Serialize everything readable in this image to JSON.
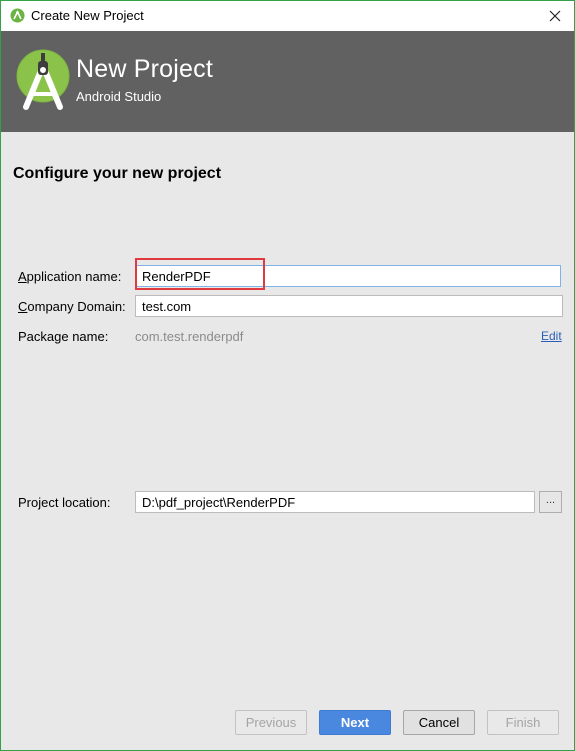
{
  "window": {
    "title": "Create New Project",
    "close_label": "✕"
  },
  "banner": {
    "title": "New Project",
    "subtitle": "Android Studio"
  },
  "heading": "Configure your new project",
  "form": {
    "application_name": {
      "label_first": "A",
      "label_rest": "pplication name:",
      "value": "RenderPDF"
    },
    "company_domain": {
      "label_first": "C",
      "label_rest": "ompany Domain:",
      "value": "test.com"
    },
    "package_name": {
      "label": "Package name:",
      "value": "com.test.renderpdf",
      "edit_label": "Edit"
    },
    "project_location": {
      "label": "Project location:",
      "value": "D:\\pdf_project\\RenderPDF",
      "browse_label": "..."
    }
  },
  "buttons": {
    "previous": "Previous",
    "next": "Next",
    "cancel": "Cancel",
    "finish": "Finish"
  },
  "colors": {
    "banner_bg": "#616161",
    "primary_button": "#4a88df",
    "highlight_box": "#e0393e",
    "window_border": "#33a04a",
    "android_green": "#8bc34a"
  }
}
